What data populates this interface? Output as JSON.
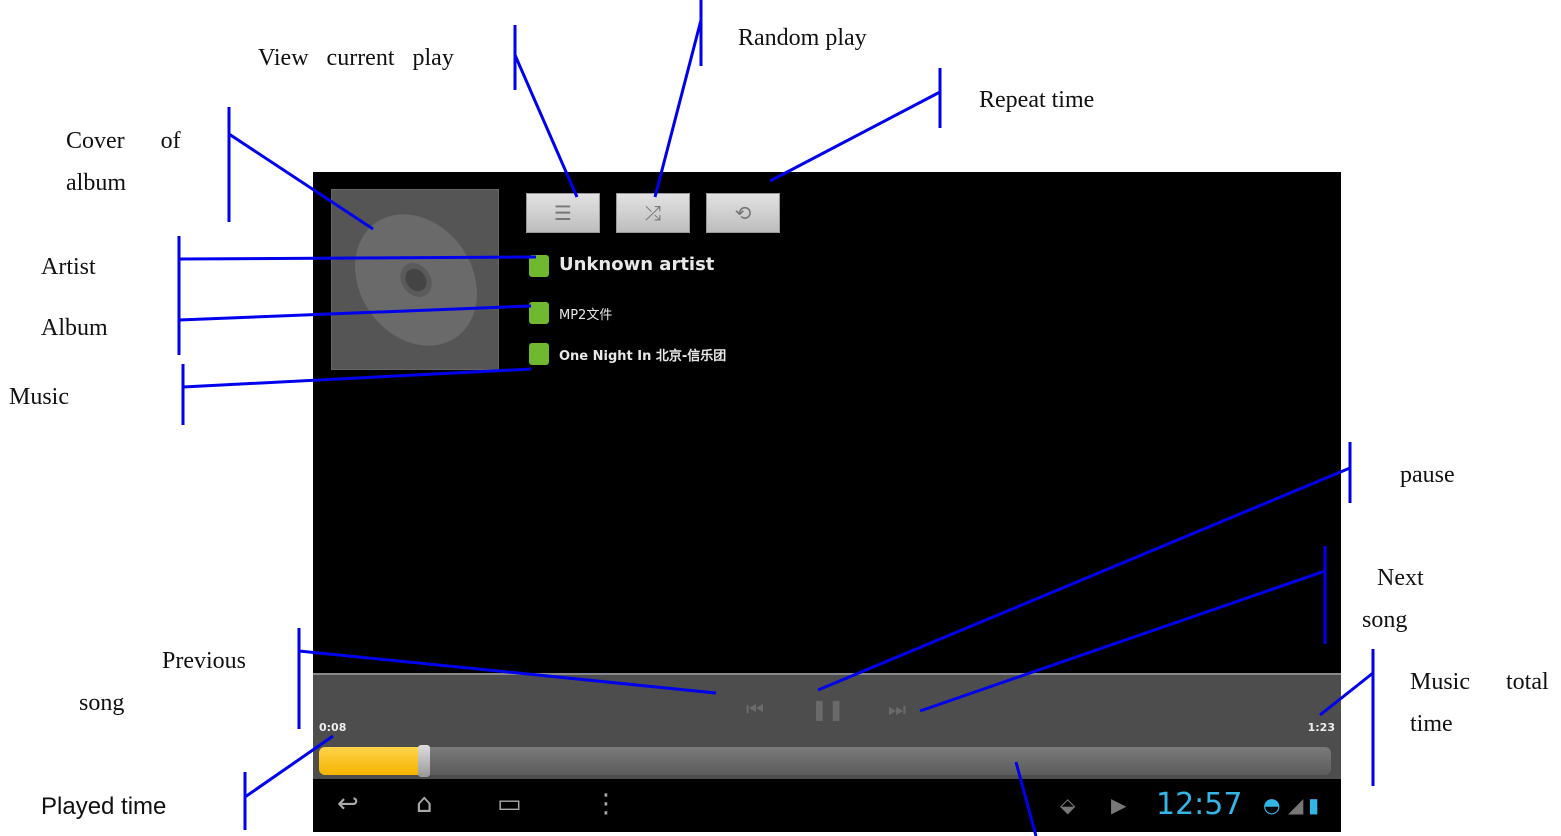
{
  "annotations": {
    "view_current_play": "View   current   play",
    "random_play": "Random play",
    "repeat_time": "Repeat time",
    "cover_line1": "Cover      of",
    "cover_line2": "album",
    "artist": "Artist",
    "album": "Album",
    "music": "Music",
    "pause": "pause",
    "next_line1": "Next",
    "next_line2": "song",
    "previous_line1": "Previous",
    "previous_line2": "song",
    "total_line1": "Music      total",
    "total_line2": "time",
    "played_time": "Played time"
  },
  "player": {
    "artist": "Unknown artist",
    "album": "MP2文件",
    "song": "One Night In 北京-信乐团",
    "elapsed": "0:08",
    "total": "1:23",
    "progress_fraction": 0.1,
    "buttons": {
      "queue_icon": "list-icon",
      "shuffle_icon": "shuffle-icon",
      "repeat_icon": "repeat-icon",
      "prev_icon": "skip-previous-icon",
      "pause_icon": "pause-icon",
      "next_icon": "skip-next-icon"
    },
    "accent_color": "#f5b400"
  },
  "status_bar": {
    "clock": "12:57"
  }
}
